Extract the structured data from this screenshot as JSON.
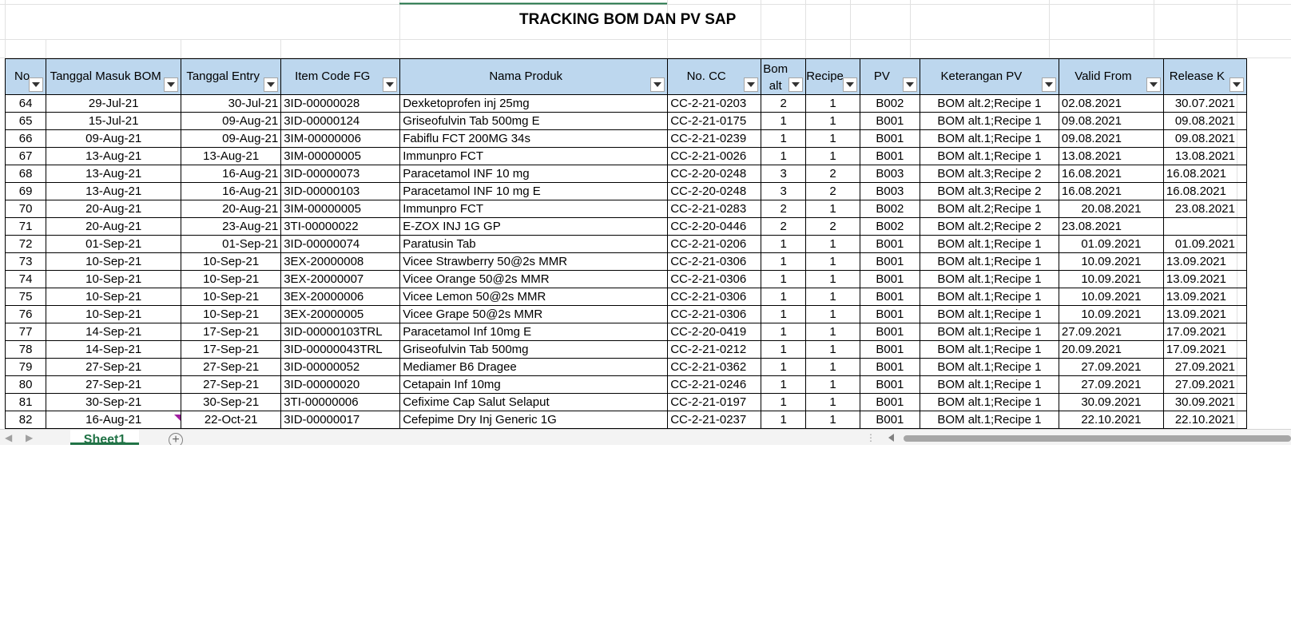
{
  "title": "TRACKING BOM DAN PV SAP",
  "columns": [
    "No",
    "Tanggal Masuk BOM",
    "Tanggal Entry",
    "Item Code FG",
    "Nama Produk",
    "No. CC",
    "Bom alt",
    "Recipe",
    "PV",
    "Keterangan PV",
    "Valid From",
    "Release K"
  ],
  "rows": [
    [
      "64",
      "29-Jul-21",
      "30-Jul-21",
      "3ID-00000028",
      "Dexketoprofen inj 25mg",
      "CC-2-21-0203",
      "2",
      "1",
      "B002",
      "BOM alt.2;Recipe 1",
      "02.08.2021",
      "30.07.2021"
    ],
    [
      "65",
      "15-Jul-21",
      "09-Aug-21",
      "3ID-00000124",
      "Griseofulvin Tab 500mg E",
      "CC-2-21-0175",
      "1",
      "1",
      "B001",
      "BOM alt.1;Recipe 1",
      "09.08.2021",
      "09.08.2021"
    ],
    [
      "66",
      "09-Aug-21",
      "09-Aug-21",
      "3IM-00000006",
      "Fabiflu FCT 200MG 34s",
      "CC-2-21-0239",
      "1",
      "1",
      "B001",
      "BOM alt.1;Recipe 1",
      "09.08.2021",
      "09.08.2021"
    ],
    [
      "67",
      "13-Aug-21",
      "13-Aug-21",
      "3IM-00000005",
      "Immunpro FCT",
      "CC-2-21-0026",
      "1",
      "1",
      "B001",
      "BOM alt.1;Recipe 1",
      "13.08.2021",
      "13.08.2021"
    ],
    [
      "68",
      "13-Aug-21",
      "16-Aug-21",
      "3ID-00000073",
      "Paracetamol INF 10 mg",
      "CC-2-20-0248",
      "3",
      "2",
      "B003",
      "BOM alt.3;Recipe 2",
      "16.08.2021",
      "16.08.2021"
    ],
    [
      "69",
      "13-Aug-21",
      "16-Aug-21",
      "3ID-00000103",
      "Paracetamol INF 10 mg E",
      "CC-2-20-0248",
      "3",
      "2",
      "B003",
      "BOM alt.3;Recipe 2",
      "16.08.2021",
      "16.08.2021"
    ],
    [
      "70",
      "20-Aug-21",
      "20-Aug-21",
      "3IM-00000005",
      "Immunpro FCT",
      "CC-2-21-0283",
      "2",
      "1",
      "B002",
      "BOM alt.2;Recipe 1",
      "20.08.2021",
      "23.08.2021"
    ],
    [
      "71",
      "20-Aug-21",
      "23-Aug-21",
      "3TI-00000022",
      "E-ZOX INJ 1G GP",
      "CC-2-20-0446",
      "2",
      "2",
      "B002",
      "BOM alt.2;Recipe 2",
      "23.08.2021",
      ""
    ],
    [
      "72",
      "01-Sep-21",
      "01-Sep-21",
      "3ID-00000074",
      "Paratusin Tab",
      "CC-2-21-0206",
      "1",
      "1",
      "B001",
      "BOM alt.1;Recipe 1",
      "01.09.2021",
      "01.09.2021"
    ],
    [
      "73",
      "10-Sep-21",
      "10-Sep-21",
      "3EX-20000008",
      "Vicee Strawberry 50@2s MMR",
      "CC-2-21-0306",
      "1",
      "1",
      "B001",
      "BOM alt.1;Recipe 1",
      "10.09.2021",
      "13.09.2021"
    ],
    [
      "74",
      "10-Sep-21",
      "10-Sep-21",
      "3EX-20000007",
      "Vicee Orange 50@2s MMR",
      "CC-2-21-0306",
      "1",
      "1",
      "B001",
      "BOM alt.1;Recipe 1",
      "10.09.2021",
      "13.09.2021"
    ],
    [
      "75",
      "10-Sep-21",
      "10-Sep-21",
      "3EX-20000006",
      "Vicee Lemon 50@2s MMR",
      "CC-2-21-0306",
      "1",
      "1",
      "B001",
      "BOM alt.1;Recipe 1",
      "10.09.2021",
      "13.09.2021"
    ],
    [
      "76",
      "10-Sep-21",
      "10-Sep-21",
      "3EX-20000005",
      "Vicee Grape 50@2s MMR",
      "CC-2-21-0306",
      "1",
      "1",
      "B001",
      "BOM alt.1;Recipe 1",
      "10.09.2021",
      "13.09.2021"
    ],
    [
      "77",
      "14-Sep-21",
      "17-Sep-21",
      "3ID-00000103TRL",
      "Paracetamol Inf 10mg E",
      "CC-2-20-0419",
      "1",
      "1",
      "B001",
      "BOM alt.1;Recipe 1",
      "27.09.2021",
      "17.09.2021"
    ],
    [
      "78",
      "14-Sep-21",
      "17-Sep-21",
      "3ID-00000043TRL",
      "Griseofulvin Tab 500mg",
      "CC-2-21-0212",
      "1",
      "1",
      "B001",
      "BOM alt.1;Recipe 1",
      "20.09.2021",
      "17.09.2021"
    ],
    [
      "79",
      "27-Sep-21",
      "27-Sep-21",
      "3ID-00000052",
      "Mediamer B6 Dragee",
      "CC-2-21-0362",
      "1",
      "1",
      "B001",
      "BOM alt.1;Recipe 1",
      "27.09.2021",
      "27.09.2021"
    ],
    [
      "80",
      "27-Sep-21",
      "27-Sep-21",
      "3ID-00000020",
      "Cetapain Inf 10mg",
      "CC-2-21-0246",
      "1",
      "1",
      "B001",
      "BOM alt.1;Recipe 1",
      "27.09.2021",
      "27.09.2021"
    ],
    [
      "81",
      "30-Sep-21",
      "30-Sep-21",
      "3TI-00000006",
      "Cefixime Cap Salut Selaput",
      "CC-2-21-0197",
      "1",
      "1",
      "B001",
      "BOM alt.1;Recipe 1",
      "30.09.2021",
      "30.09.2021"
    ],
    [
      "82",
      "16-Aug-21",
      "22-Oct-21",
      "3ID-00000017",
      "Cefepime Dry Inj Generic 1G",
      "CC-2-21-0237",
      "1",
      "1",
      "B001",
      "BOM alt.1;Recipe 1",
      "22.10.2021",
      "22.10.2021"
    ]
  ],
  "sheet_tab": "Sheet1",
  "add_sheet": "+",
  "colors": {
    "header_fill": "#bdd7ee",
    "tab_accent": "#217346",
    "comment_marker": "#a020a0"
  }
}
